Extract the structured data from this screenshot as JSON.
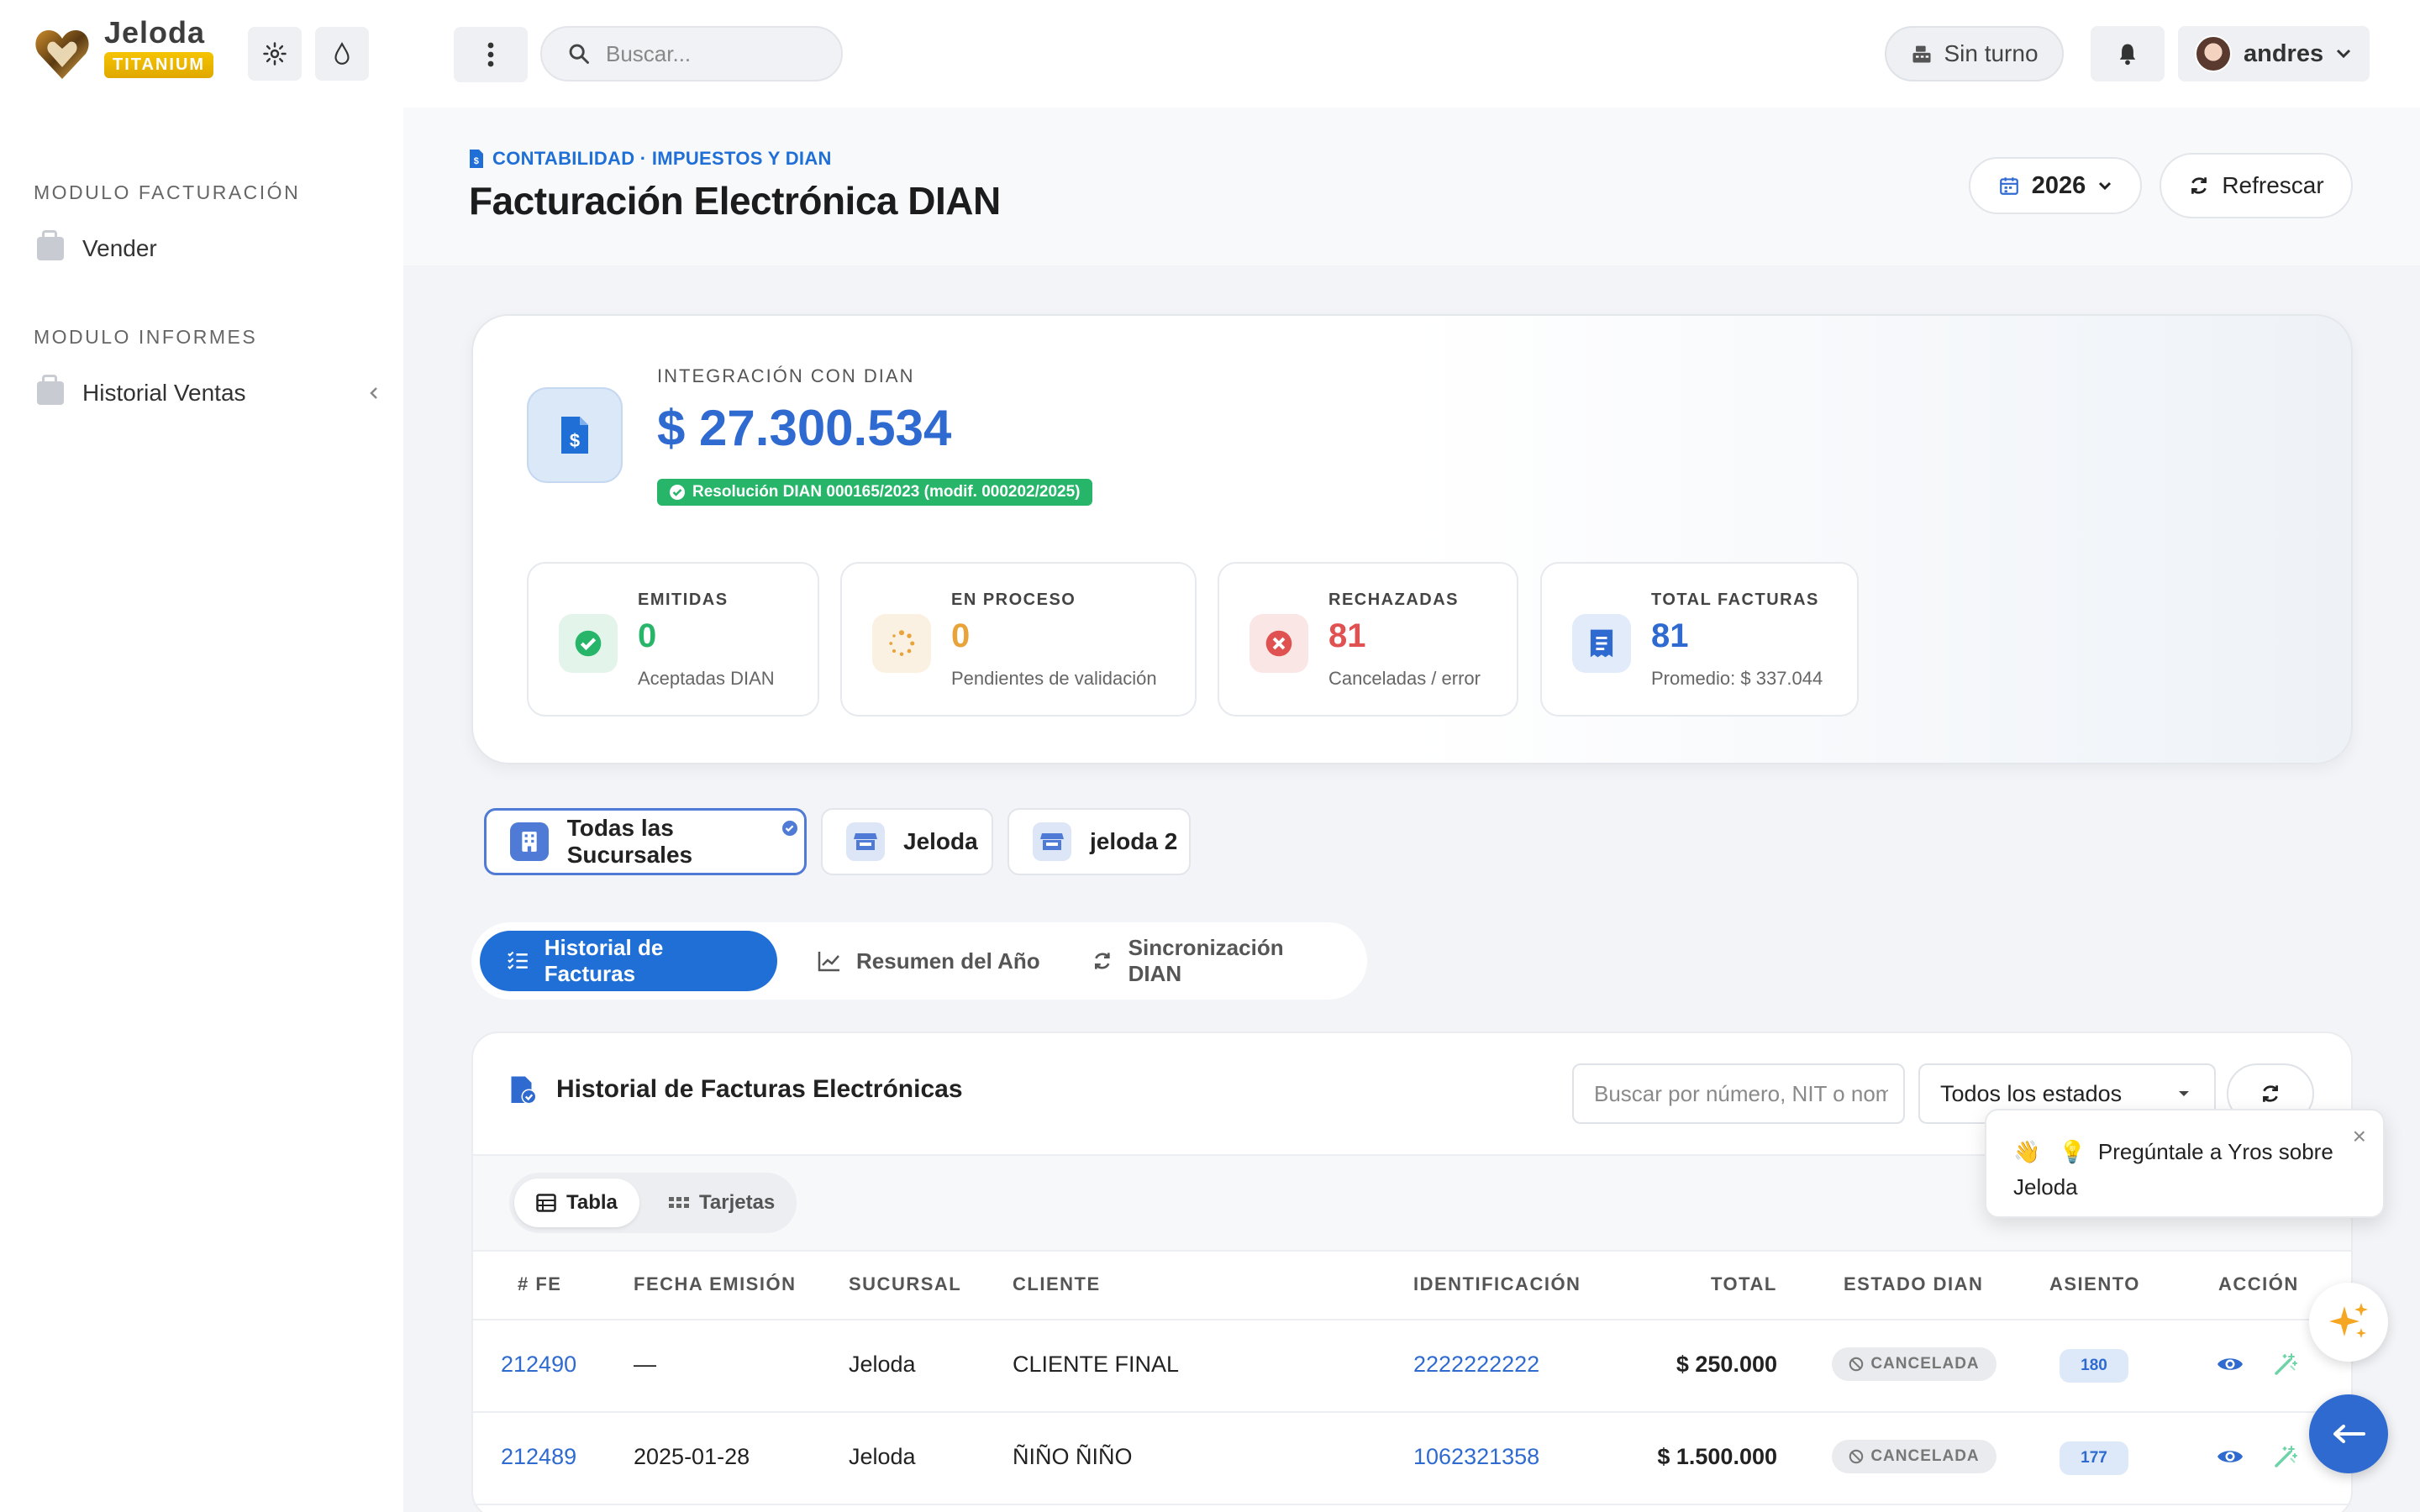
{
  "brand": {
    "name": "Jeloda",
    "tier": "TITANIUM",
    "accent": "#f5c400"
  },
  "topbar": {
    "search_placeholder": "Buscar...",
    "shift_label": "Sin turno",
    "user_name": "andres",
    "icons": [
      "gear-icon",
      "droplet-icon",
      "kebab-menu-icon",
      "search-icon",
      "cash-register-icon",
      "bell-icon",
      "chevron-down-icon"
    ]
  },
  "sidebar": {
    "sections": [
      {
        "title": "MODULO FACTURACIÓN",
        "items": [
          {
            "label": "Vender"
          }
        ]
      },
      {
        "title": "MODULO INFORMES",
        "items": [
          {
            "label": "Historial Ventas"
          }
        ]
      }
    ]
  },
  "header": {
    "breadcrumb": "CONTABILIDAD · IMPUESTOS Y DIAN",
    "title": "Facturación Electrónica DIAN",
    "year": "2026",
    "refresh_label": "Refrescar"
  },
  "summary": {
    "label": "INTEGRACIÓN CON DIAN",
    "amount": "$ 27.300.534",
    "resolution": "Resolución DIAN 000165/2023 (modif. 000202/2025)",
    "stats": [
      {
        "label": "EMITIDAS",
        "value": "0",
        "sub": "Aceptadas DIAN",
        "color": "#27b56a"
      },
      {
        "label": "EN PROCESO",
        "value": "0",
        "sub": "Pendientes de validación",
        "color": "#e8a33a"
      },
      {
        "label": "RECHAZADAS",
        "value": "81",
        "sub": "Canceladas / error",
        "color": "#e05252"
      },
      {
        "label": "TOTAL FACTURAS",
        "value": "81",
        "sub": "Promedio: $ 337.044",
        "color": "#2f6ad0"
      }
    ]
  },
  "branches": [
    {
      "label": "Todas las Sucursales",
      "active": true
    },
    {
      "label": "Jeloda",
      "active": false
    },
    {
      "label": "jeloda 2",
      "active": false
    }
  ],
  "tabs": [
    {
      "label": "Historial de Facturas",
      "active": true
    },
    {
      "label": "Resumen del Año",
      "active": false
    },
    {
      "label": "Sincronización DIAN",
      "active": false
    }
  ],
  "table": {
    "title": "Historial de Facturas Electrónicas",
    "search_placeholder": "Buscar por número, NIT o nombre",
    "status_filter": "Todos los estados",
    "view_modes": [
      "Tabla",
      "Tarjetas"
    ],
    "columns": [
      "# FE",
      "FECHA EMISIÓN",
      "SUCURSAL",
      "CLIENTE",
      "IDENTIFICACIÓN",
      "TOTAL",
      "ESTADO DIAN",
      "ASIENTO",
      "ACCIÓN"
    ],
    "rows": [
      {
        "fe": "212490",
        "fecha": "—",
        "sucursal": "Jeloda",
        "cliente": "CLIENTE FINAL",
        "id": "2222222222",
        "total": "$ 250.000",
        "estado": "CANCELADA",
        "asiento": "180"
      },
      {
        "fe": "212489",
        "fecha": "2025-01-28",
        "sucursal": "Jeloda",
        "cliente": "ÑIÑO ÑIÑO",
        "id": "1062321358",
        "total": "$ 1.500.000",
        "estado": "CANCELADA",
        "asiento": "177"
      }
    ]
  },
  "assistant": {
    "tooltip_emoji": "👋",
    "tooltip_bulb": "💡",
    "tooltip_text": "Pregúntale a Yros sobre Jeloda",
    "close": "×"
  }
}
